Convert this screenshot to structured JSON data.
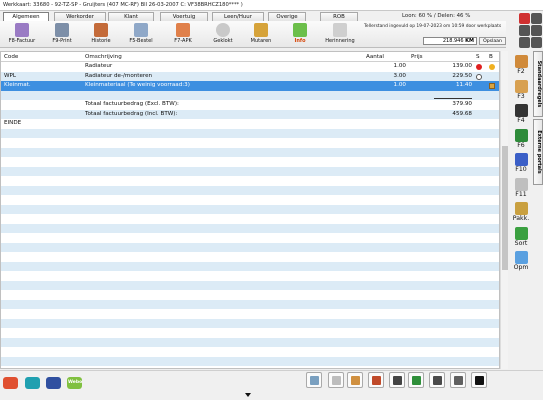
{
  "window": {
    "title": "Werkkaart: 33680 - 92-TZ-SP - Gruijters  (407 MC-RF) Bll 26-03-2007 C: VF38BRHCZ180****  )"
  },
  "tabs": [
    "Algemeen",
    "Werkorder",
    "Klant",
    "Voertuig",
    "Leen/Huur",
    "Overige",
    "ROB"
  ],
  "loon_delen": "Loon: 60 % / Delen: 46 %",
  "toolbar": {
    "buttons": [
      {
        "label": "F8-Factuur",
        "icon": "invoice-icon",
        "color": "#9a7bc4"
      },
      {
        "label": "F9-Print",
        "icon": "print-icon",
        "color": "#7d8fa8"
      },
      {
        "label": "Historie",
        "icon": "history-icon",
        "color": "#c46b3a"
      },
      {
        "label": "F5-Bestel",
        "icon": "order-icon",
        "color": "#8fa8c8"
      },
      {
        "label": "F7-APK",
        "icon": "apk-icon",
        "color": "#e0804a"
      },
      {
        "label": "Geklokt",
        "icon": "clock-icon",
        "color": "#c9c9c9"
      },
      {
        "label": "Mutaren",
        "icon": "stack-icon",
        "color": "#d6a33a"
      },
      {
        "label": "Info",
        "icon": "info-icon",
        "color": "#6cbf4a"
      },
      {
        "label": "Herinnering",
        "icon": "reminder-icon",
        "color": "#cfcfcf"
      }
    ],
    "note": "Tellerstand ingevuld op 19-07-2023 om 10:59 door werkplaats",
    "km_value": "218.946",
    "km_unit": "KM",
    "save_label": "Opslaan"
  },
  "grid": {
    "headers": {
      "code": "Code",
      "omschrijving": "Omschrijving",
      "aantal": "Aantal",
      "prijs": "Prijs",
      "s": "S",
      "b": "B"
    },
    "rows": [
      {
        "code": "",
        "omschrijving": "Radiateur",
        "aantal": "1.00",
        "prijs": "139.00",
        "s": "red",
        "b": "yellow",
        "sel": false
      },
      {
        "code": "WPL",
        "omschrijving": "Radiateur de-/monteren",
        "aantal": "3.00",
        "prijs": "229.50",
        "s": "empty",
        "b": "",
        "sel": false
      },
      {
        "code": "Kleinmat.",
        "omschrijving": "Kleinmateriaal (Te weinig voorraad:3)",
        "aantal": "1.00",
        "prijs": "11.40",
        "s": "",
        "b": "box",
        "sel": true
      },
      {
        "code": "",
        "omschrijving": "",
        "aantal": "",
        "prijs": "",
        "s": "",
        "b": "",
        "sel": false
      },
      {
        "code": "",
        "omschrijving": "Totaal factuurbedrag (Excl. BTW):",
        "aantal": "",
        "prijs": "379.90",
        "s": "",
        "b": "",
        "sel": false
      },
      {
        "code": "",
        "omschrijving": "Totaal factuurbedrag (Incl. BTW):",
        "aantal": "",
        "prijs": "459.68",
        "s": "",
        "b": "",
        "sel": false
      },
      {
        "code": "EINDE",
        "omschrijving": "",
        "aantal": "",
        "prijs": "",
        "s": "",
        "b": "",
        "sel": false
      }
    ]
  },
  "right_panel": [
    {
      "label": "F2",
      "icon": "tools-icon",
      "color": "#d08a3a"
    },
    {
      "label": "F3",
      "icon": "parts-icon",
      "color": "#d8a050"
    },
    {
      "label": "F4",
      "icon": "tire-icon",
      "color": "#333333"
    },
    {
      "label": "F6",
      "icon": "oil-icon",
      "color": "#2e8b3a"
    },
    {
      "label": "F10",
      "icon": "fuel-icon",
      "color": "#3b5fc7"
    },
    {
      "label": "F11",
      "icon": "note-icon",
      "color": "#bfbfbf"
    },
    {
      "label": "Pakk.",
      "icon": "package-icon",
      "color": "#c9a040"
    },
    {
      "label": "Sort",
      "icon": "sort-icon",
      "color": "#3aa040"
    },
    {
      "label": "Opm",
      "icon": "comment-icon",
      "color": "#5aa0e0"
    }
  ],
  "vertical_tabs": [
    "Standaardregels",
    "Externe portals"
  ],
  "bottom_bar": {
    "logos": [
      {
        "color": "#e05030"
      },
      {
        "color": "#20a0b0"
      },
      {
        "color": "#3050a0"
      },
      {
        "color": "#80c040"
      }
    ],
    "logo_text": "Webo",
    "buttons": [
      {
        "icon": "screen-icon",
        "color": "#7aa0c0"
      },
      {
        "icon": "check-icon",
        "color": "#bdbdbd"
      },
      {
        "icon": "flag-icon",
        "color": "#d09040"
      },
      {
        "icon": "hammer-icon",
        "color": "#c04a2a"
      },
      {
        "icon": "stopwatch-icon",
        "color": "#444444"
      },
      {
        "icon": "wrench-icon",
        "color": "#2f8f3a"
      },
      {
        "icon": "document-icon",
        "color": "#4a4a4a"
      },
      {
        "icon": "picture-icon",
        "color": "#606060"
      },
      {
        "icon": "drop-icon",
        "color": "#111111"
      }
    ]
  }
}
